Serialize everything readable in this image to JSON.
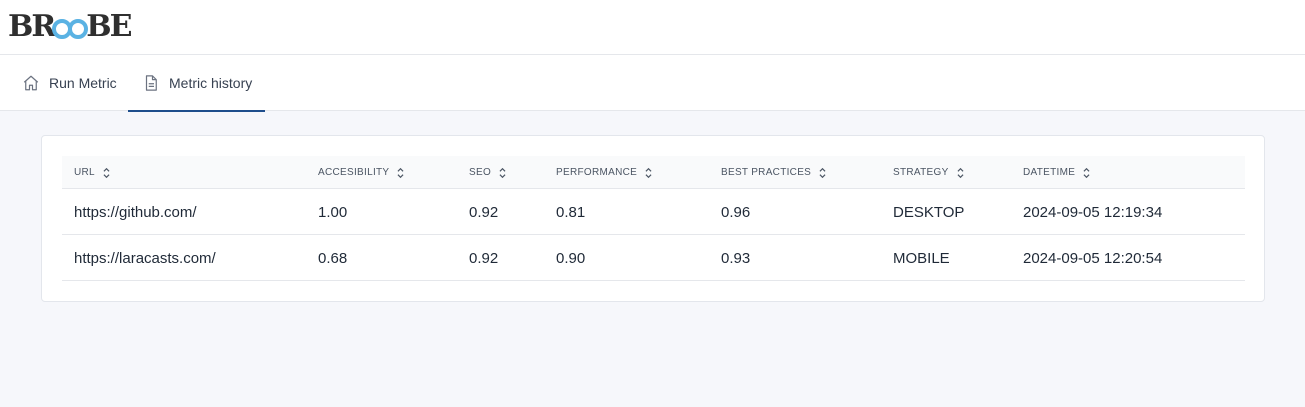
{
  "brand": {
    "name": "BROOBE",
    "part1": "BR",
    "part2": "O",
    "part3": "O",
    "part4": "BE"
  },
  "tabs": [
    {
      "label": "Run Metric",
      "icon": "home-icon",
      "active": false
    },
    {
      "label": "Metric history",
      "icon": "document-icon",
      "active": true
    }
  ],
  "colors": {
    "accent": "#1e4e8c",
    "logo_blue": "#5ab2e3",
    "background": "#f6f7fb"
  },
  "table": {
    "columns": [
      "URL",
      "ACCESIBILITY",
      "SEO",
      "PERFORMANCE",
      "BEST PRACTICES",
      "STRATEGY",
      "DATETIME"
    ],
    "rows": [
      [
        "https://github.com/",
        "1.00",
        "0.92",
        "0.81",
        "0.96",
        "DESKTOP",
        "2024-09-05 12:19:34"
      ],
      [
        "https://laracasts.com/",
        "0.68",
        "0.92",
        "0.90",
        "0.93",
        "MOBILE",
        "2024-09-05 12:20:54"
      ]
    ]
  }
}
